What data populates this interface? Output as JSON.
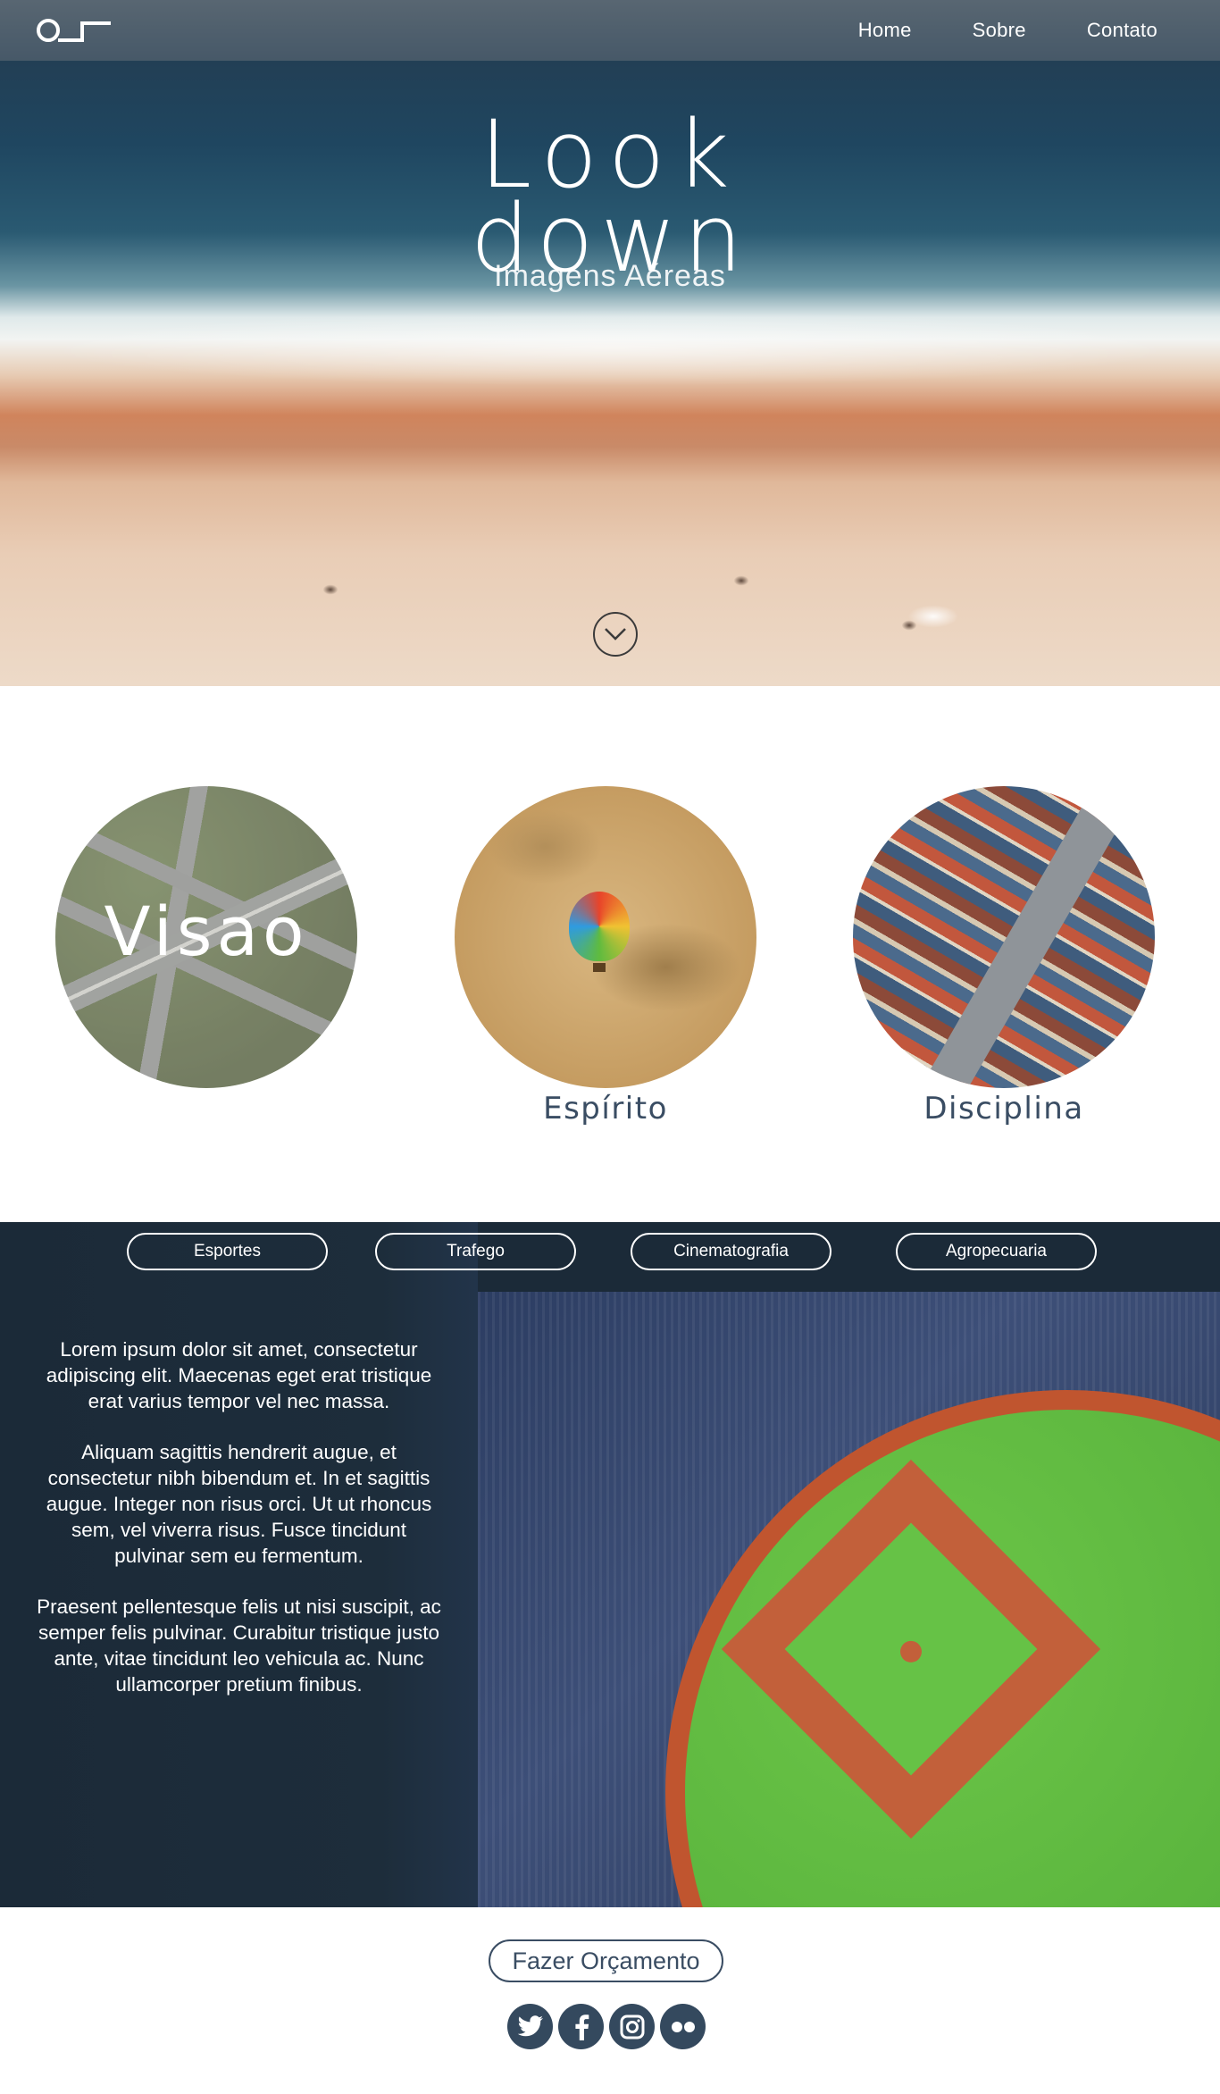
{
  "nav": {
    "links": [
      "Home",
      "Sobre",
      "Contato"
    ]
  },
  "hero": {
    "title_line1": "Look",
    "title_line2": "down",
    "subtitle": "Imagens Aéreas"
  },
  "features": {
    "items": [
      {
        "label": "Visao"
      },
      {
        "label": "Espírito"
      },
      {
        "label": "Disciplina"
      }
    ]
  },
  "categories": {
    "tabs": [
      "Esportes",
      "Trafego",
      "Cinematografia",
      "Agropecuaria"
    ]
  },
  "content": {
    "paragraphs": [
      "Lorem ipsum dolor sit amet, consectetur adipiscing elit. Maecenas eget erat tristique erat varius tempor vel nec massa.",
      "Aliquam sagittis hendrerit augue, et consectetur nibh bibendum et. In et sagittis augue. Integer non risus orci. Ut ut rhoncus sem, vel viverra risus. Fusce tincidunt pulvinar sem eu fermentum.",
      "Praesent pellentesque felis ut nisi suscipit, ac semper felis pulvinar. Curabitur tristique justo ante, vitae tincidunt leo vehicula ac. Nunc ullamcorper pretium finibus."
    ]
  },
  "footer": {
    "cta_label": "Fazer Orçamento",
    "socials": [
      "twitter-icon",
      "facebook-icon",
      "instagram-icon",
      "flickr-icon"
    ]
  },
  "colors": {
    "accent": "#34495e",
    "caption_text": "#3a4d63",
    "dark_section": "#1b2a38"
  }
}
